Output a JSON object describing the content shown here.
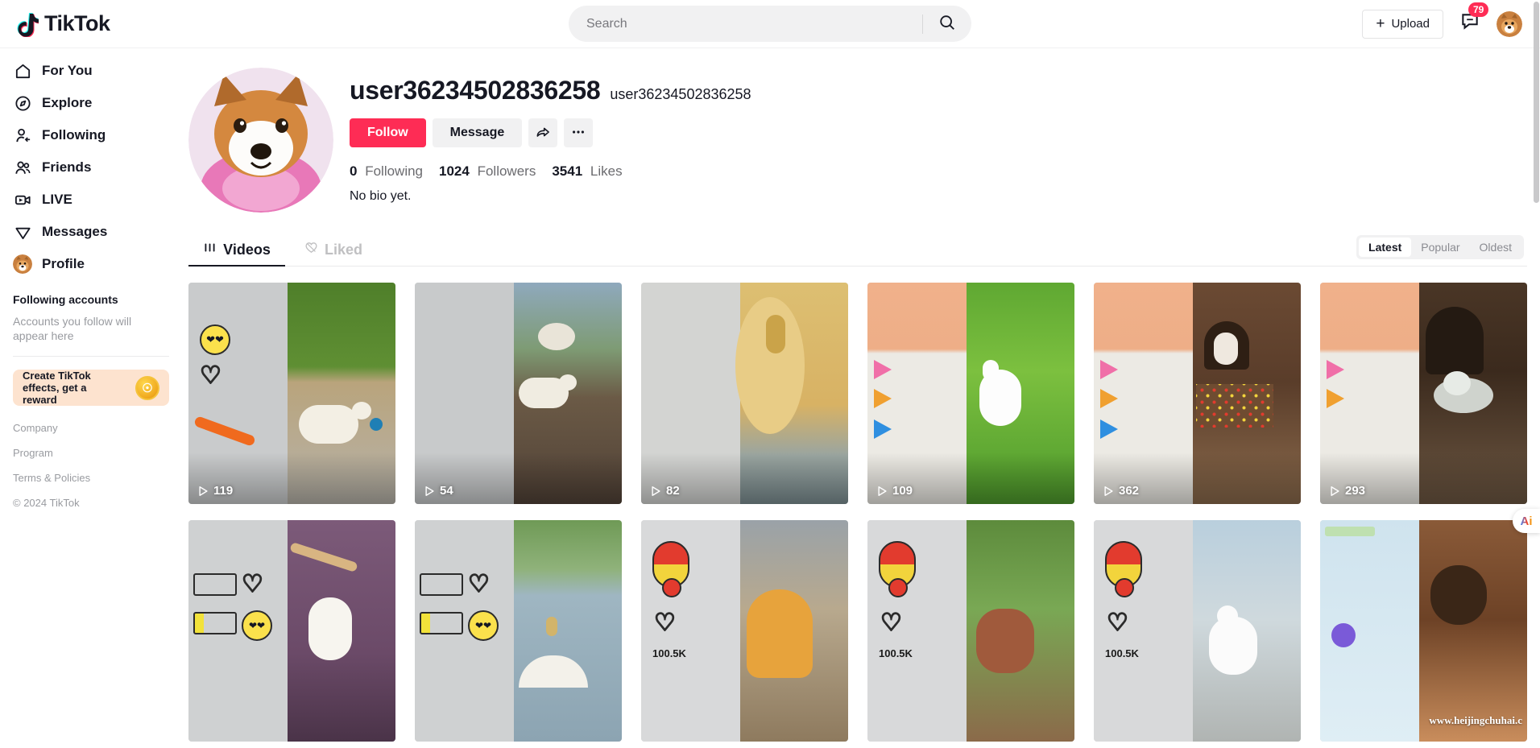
{
  "header": {
    "logo_text": "TikTok",
    "logo_icon": "tiktok-note-icon",
    "search": {
      "placeholder": "Search",
      "value": "",
      "icon": "search-icon"
    },
    "upload_label": "Upload",
    "upload_icon": "plus-icon",
    "messages_icon": "message-icon",
    "messages_badge": "79",
    "avatar_icon": "user-avatar"
  },
  "sidebar": {
    "items": [
      {
        "label": "For You",
        "icon": "home-icon"
      },
      {
        "label": "Explore",
        "icon": "compass-icon"
      },
      {
        "label": "Following",
        "icon": "following-user-icon"
      },
      {
        "label": "Friends",
        "icon": "friends-icon"
      },
      {
        "label": "LIVE",
        "icon": "live-video-icon"
      },
      {
        "label": "Messages",
        "icon": "send-paperplane-icon"
      },
      {
        "label": "Profile",
        "icon": "profile-avatar-icon"
      }
    ],
    "following_heading": "Following accounts",
    "following_desc": "Accounts you follow will appear here",
    "promo": {
      "text": "Create TikTok effects, get a reward",
      "icon": "coin-icon"
    },
    "footer_links": [
      "Company",
      "Program",
      "Terms & Policies"
    ],
    "copyright": "© 2024 TikTok"
  },
  "profile": {
    "avatar_icon": "profile-large-avatar",
    "username": "user36234502836258",
    "nickname": "user36234502836258",
    "follow_label": "Follow",
    "message_label": "Message",
    "share_icon": "share-arrow-icon",
    "more_icon": "more-ellipsis-icon",
    "stats": {
      "following_count": "0",
      "following_label": "Following",
      "followers_count": "1024",
      "followers_label": "Followers",
      "likes_count": "3541",
      "likes_label": "Likes"
    },
    "bio": "No bio yet."
  },
  "tabs": [
    {
      "label": "Videos",
      "icon": "grid-bars-icon",
      "active": true
    },
    {
      "label": "Liked",
      "icon": "heart-lock-icon",
      "active": false
    }
  ],
  "sort_options": [
    {
      "label": "Latest",
      "active": true
    },
    {
      "label": "Popular",
      "active": false
    },
    {
      "label": "Oldest",
      "active": false
    }
  ],
  "videos_row1": [
    {
      "views": "119",
      "play_icon": "play-icon"
    },
    {
      "views": "54",
      "play_icon": "play-icon"
    },
    {
      "views": "82",
      "play_icon": "play-icon"
    },
    {
      "views": "109",
      "play_icon": "play-icon"
    },
    {
      "views": "362",
      "play_icon": "play-icon"
    },
    {
      "views": "293",
      "play_icon": "play-icon"
    }
  ],
  "videos_row2": [
    {
      "overlay_label": ""
    },
    {
      "overlay_label": ""
    },
    {
      "overlay_label": "100.5K"
    },
    {
      "overlay_label": "100.5K"
    },
    {
      "overlay_label": "100.5K"
    },
    {
      "overlay_label": "",
      "watermark": "www.heijingchuhai.c"
    }
  ],
  "floating": {
    "ai_label": "Ai"
  },
  "colors": {
    "accent_red": "#fe2c55",
    "accent_cyan": "#25f4ee",
    "text_primary": "#161823",
    "text_muted": "#999ba0",
    "chip_bg": "#f1f1f2",
    "promo_bg": "#fde3cf"
  }
}
